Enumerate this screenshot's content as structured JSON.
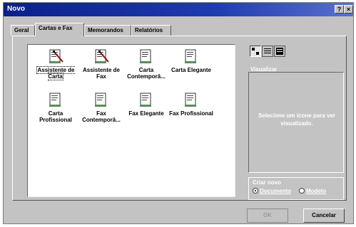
{
  "window": {
    "title": "Novo"
  },
  "titlebar": {
    "help": "?",
    "close": "×"
  },
  "tabs": [
    {
      "label": "Geral"
    },
    {
      "label": "Cartas e Fax"
    },
    {
      "label": "Memorandos"
    },
    {
      "label": "Relatórios"
    }
  ],
  "templates": [
    {
      "label": "Assistente de Carta",
      "icon": "wizard-letter-icon",
      "selected": true
    },
    {
      "label": "Assistente de Fax",
      "icon": "wizard-fax-icon"
    },
    {
      "label": "Carta Contemporâ...",
      "icon": "document-icon"
    },
    {
      "label": "Carta Elegante",
      "icon": "document-icon"
    },
    {
      "label": "Carta Profissional",
      "icon": "document-icon"
    },
    {
      "label": "Fax Contemporâ...",
      "icon": "document-icon"
    },
    {
      "label": "Fax Elegante",
      "icon": "document-icon"
    },
    {
      "label": "Fax Profissional",
      "icon": "document-icon"
    }
  ],
  "preview": {
    "label": "Visualizar",
    "message": "Selecione um ícone para ver visualizado."
  },
  "create_new": {
    "label": "Criar novo",
    "options": [
      {
        "label": "Documento",
        "selected": true
      },
      {
        "label": "Modelo",
        "selected": false
      }
    ]
  },
  "buttons": {
    "ok": "OK",
    "cancel": "Cancelar"
  }
}
